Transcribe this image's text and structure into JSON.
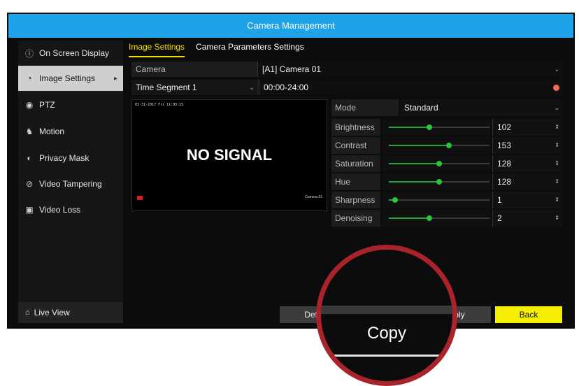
{
  "window": {
    "title": "Camera Management"
  },
  "sidebar": {
    "items": [
      {
        "label": "On Screen Display",
        "icon": "info-icon"
      },
      {
        "label": "Image Settings",
        "icon": "image-settings-icon",
        "active": true
      },
      {
        "label": "PTZ",
        "icon": "ptz-icon"
      },
      {
        "label": "Motion",
        "icon": "motion-icon"
      },
      {
        "label": "Privacy Mask",
        "icon": "privacy-mask-icon"
      },
      {
        "label": "Video Tampering",
        "icon": "tampering-icon"
      },
      {
        "label": "Video Loss",
        "icon": "video-loss-icon"
      }
    ],
    "live_view": "Live View"
  },
  "tabs": [
    "Image Settings",
    "Camera Parameters Settings"
  ],
  "camera": {
    "label": "Camera",
    "value": "[A1] Camera 01"
  },
  "segment": {
    "label": "Time Segment 1",
    "value": "00:00-24:00"
  },
  "preview": {
    "timestamp": "03-31-2017 Fri 11:05:15",
    "message": "NO SIGNAL",
    "camera_name": "Camera 01"
  },
  "mode": {
    "label": "Mode",
    "value": "Standard"
  },
  "params": [
    {
      "label": "Brightness",
      "value": "102",
      "level": 0.4
    },
    {
      "label": "Contrast",
      "value": "153",
      "level": 0.6
    },
    {
      "label": "Saturation",
      "value": "128",
      "level": 0.5
    },
    {
      "label": "Hue",
      "value": "128",
      "level": 0.5
    },
    {
      "label": "Sharpness",
      "value": "1",
      "level": 0.06
    },
    {
      "label": "Denoising",
      "value": "2",
      "level": 0.4
    }
  ],
  "buttons": {
    "default": "Defa",
    "apply": "ply",
    "back": "Back"
  },
  "magnifier": {
    "label": "Copy"
  },
  "colors": {
    "accent": "#1ea2e8",
    "active_tab": "#f2e000",
    "back_button": "#f5ee00",
    "highlight_circle": "#a8242a",
    "slider": "#2ec53e"
  }
}
